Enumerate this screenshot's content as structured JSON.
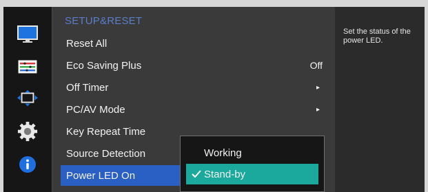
{
  "menu": {
    "title": "SETUP&RESET",
    "items": [
      {
        "label": "Reset All",
        "value": "",
        "arrow": ""
      },
      {
        "label": "Eco Saving Plus",
        "value": "Off",
        "arrow": ""
      },
      {
        "label": "Off Timer",
        "value": "",
        "arrow": "▸"
      },
      {
        "label": "PC/AV Mode",
        "value": "",
        "arrow": "▸"
      },
      {
        "label": "Key Repeat Time",
        "value": "",
        "arrow": ""
      },
      {
        "label": "Source Detection",
        "value": "",
        "arrow": ""
      },
      {
        "label": "Power LED On",
        "value": "",
        "arrow": ""
      }
    ]
  },
  "popup": {
    "options": [
      {
        "label": "Working",
        "selected": false
      },
      {
        "label": "Stand-by",
        "selected": true
      }
    ]
  },
  "help": {
    "text": "Set the status of the power LED."
  },
  "sidebar": {
    "icons": [
      "monitor-icon",
      "color-bars-icon",
      "screen-size-icon",
      "gear-icon",
      "info-icon"
    ]
  },
  "colors": {
    "accent_blue": "#2a5fc3",
    "title_blue": "#5b7ec9",
    "selected_teal": "#1aa99c",
    "info_blue": "#1e6fe0"
  }
}
